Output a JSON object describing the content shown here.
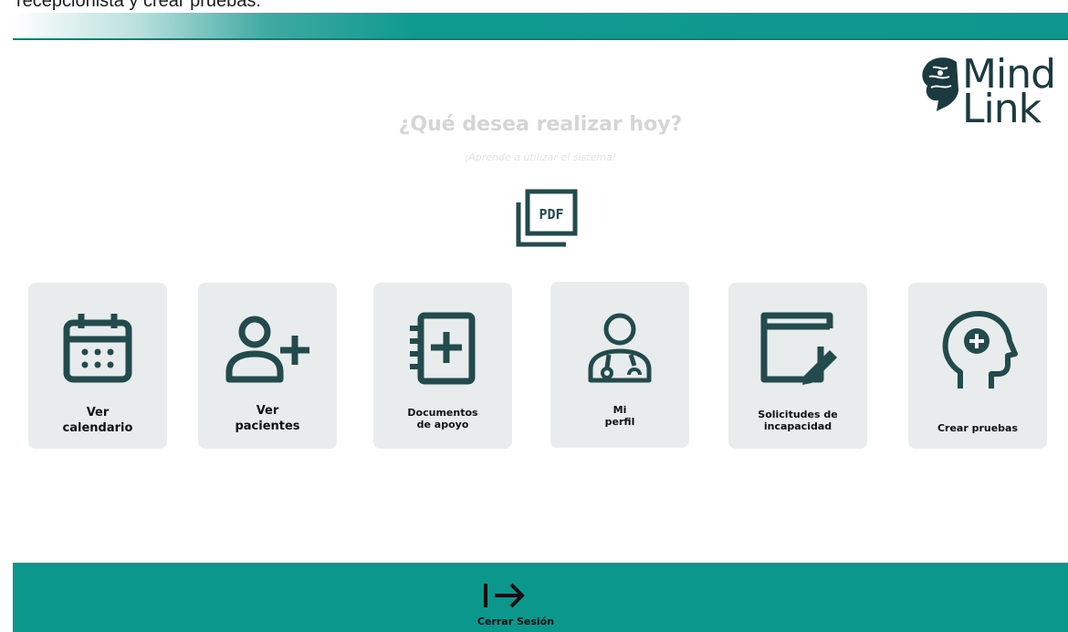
{
  "top_caption": "recepcionista y crear pruebas.",
  "logo": {
    "line1": "Mind",
    "line2": "Link"
  },
  "heading": "¿Qué desea realizar hoy?",
  "subheading": "¡Aprende a utilizar el sistema!",
  "pdf_icon_label": "PDF",
  "cards": [
    {
      "line1": "Ver",
      "line2": "calendario",
      "icon": "calendar-icon"
    },
    {
      "line1": "Ver",
      "line2": "pacientes",
      "icon": "add-user-icon"
    },
    {
      "line1": "Documentos",
      "line2": "de apoyo",
      "icon": "add-document-icon"
    },
    {
      "line1": "Mi",
      "line2": "perfil",
      "icon": "doctor-icon"
    },
    {
      "line1": "Solicitudes de",
      "line2": "incapacidad",
      "icon": "edit-window-icon"
    },
    {
      "line1": "Crear pruebas",
      "icon": "head-plus-icon"
    }
  ],
  "logout_label": "Cerrar Sesión",
  "colors": {
    "accent": "#0c978d",
    "icon_dark": "#234a4c",
    "card_bg": "#e8ecec"
  }
}
